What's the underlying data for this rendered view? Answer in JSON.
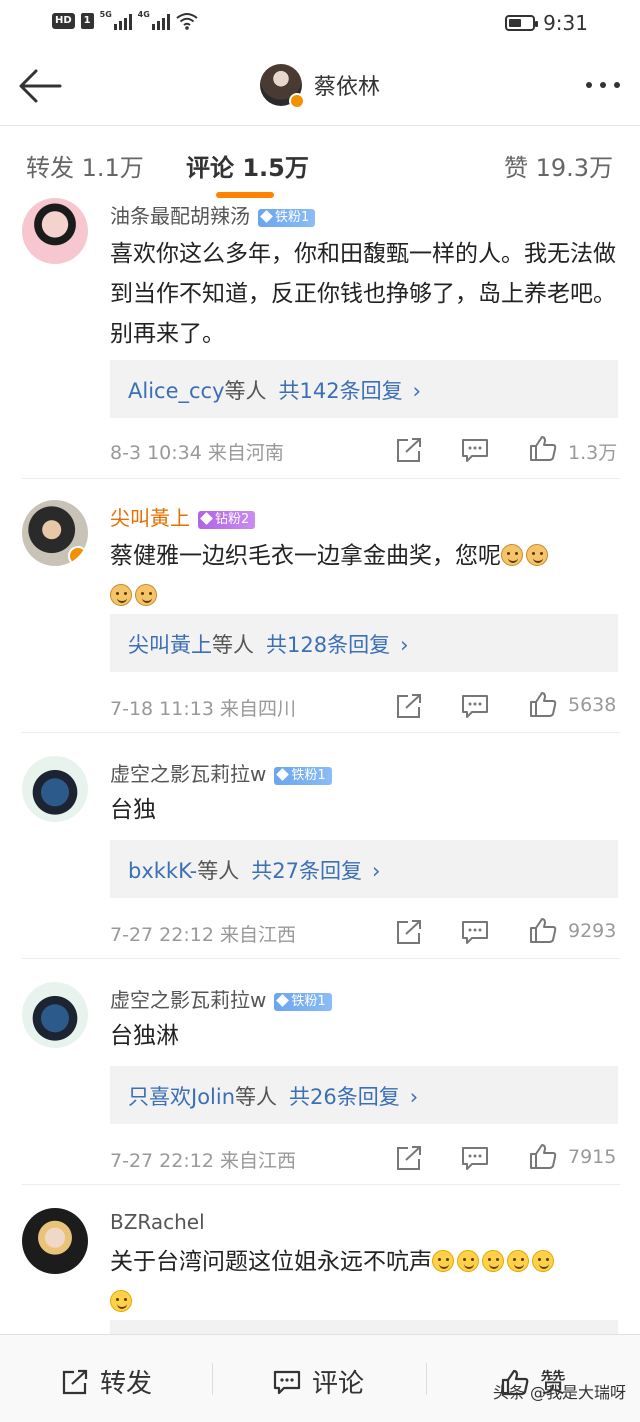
{
  "status_bar": {
    "hd_label": "HD",
    "hd_sub": "1",
    "net1": "5G",
    "net2": "4G",
    "time": "9:31",
    "battery_level": 0.55
  },
  "nav": {
    "title": "蔡依林",
    "icons": [
      "back-arrow-icon",
      "verified-icon",
      "more-icon"
    ]
  },
  "tabs": {
    "repost": "转发 1.1万",
    "comments": "评论 1.5万",
    "likes": "赞 19.3万"
  },
  "comments": [
    {
      "user": "油条最配胡辣汤",
      "badge": "铁粉1",
      "text": "喜欢你这么多年，你和田馥甄一样的人。我无法做到当作不知道，反正你钱也挣够了，岛上养老吧。别再来了。",
      "reply_who": "Alice_ccy",
      "reply_suffix": "等人",
      "reply_count": "共142条回复",
      "meta": "8-3 10:34  来自河南",
      "likes": "1.3万"
    },
    {
      "user": "尖叫黃上",
      "badge": "钻粉2",
      "text": "蔡健雅一边织毛衣一边拿金曲奖，您呢",
      "reply_who": "尖叫黃上",
      "reply_suffix": "等人",
      "reply_count": "共128条回复",
      "meta": "7-18 11:13  来自四川",
      "likes": "5638"
    },
    {
      "user": "虚空之影瓦莉拉w",
      "badge": "铁粉1",
      "text": "台独",
      "reply_who": "bxkkK-",
      "reply_suffix": "等人",
      "reply_count": "共27条回复",
      "meta": "7-27 22:12  来自江西",
      "likes": "9293"
    },
    {
      "user": "虚空之影瓦莉拉w",
      "badge": "铁粉1",
      "text": "台独淋",
      "reply_who": "只喜欢Jolin",
      "reply_suffix": "等人",
      "reply_count": "共26条回复",
      "meta": "7-27 22:12  来自江西",
      "likes": "7915"
    },
    {
      "user": "BZRachel",
      "text": "关于台湾问题这位姐永远不吭声"
    }
  ],
  "reply_chevron": "›",
  "bottom": {
    "repost": "转发",
    "comment": "评论",
    "like": "赞",
    "watermark": "头条 @我是大瑞呀"
  },
  "colors": {
    "accent": "#ff8200",
    "link": "#3b6fb6",
    "gold_name": "#e86e00",
    "badge_blue": "#6aa6ee",
    "badge_purple": "#b064e6"
  }
}
